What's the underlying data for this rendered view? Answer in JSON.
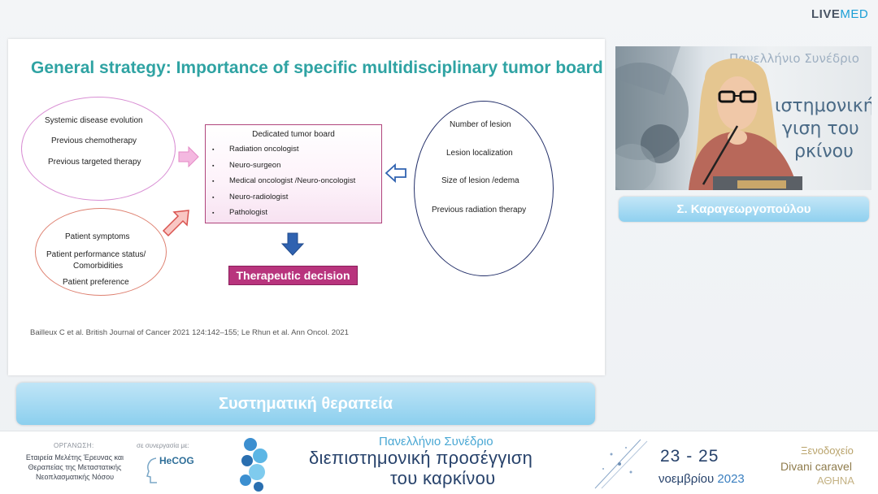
{
  "brand": {
    "part1": "LIVE",
    "part2": "MED"
  },
  "slide": {
    "title": "General strategy: Importance of specific multidisciplinary tumor board",
    "left_ellipse_top": [
      "Systemic disease evolution",
      "Previous chemotherapy",
      "Previous targeted therapy"
    ],
    "left_ellipse_bottom": [
      "Patient symptoms",
      "Patient performance status/",
      "Comorbidities",
      "Patient preference"
    ],
    "right_ellipse": [
      "Number of lesion",
      "Lesion localization",
      "Size of lesion /edema",
      "Previous radiation therapy"
    ],
    "board": {
      "title": "Dedicated tumor board",
      "bullet": "▪",
      "items": [
        "Radiation oncologist",
        "Neuro-surgeon",
        "Medical oncologist /Neuro-oncologist",
        "Neuro-radiologist",
        "Pathologist"
      ]
    },
    "decision": "Therapeutic decision",
    "reference": "Bailleux C et al. British Journal of Cancer 2021 124:142–155; Le Rhun et al.  Ann Oncol. 2021"
  },
  "speaker": {
    "name": "Σ. Καραγεωργοπούλου"
  },
  "topic": "Συστηματική θεραπεία",
  "footer": {
    "organizer_label": "ΟΡΓΑΝΩΣΗ:",
    "organizer_lines": [
      "Εταιρεία Μελέτης Έρευνας και",
      "Θεραπείας της Μεταστατικής",
      "Νεοπλασματικής Νόσου"
    ],
    "collab_label": "σε συνεργασία με:",
    "collab_name": "HeCOG",
    "conf_prefix": "Πανελλήνιο Συνέδριο",
    "conf_line1": "διεπιστημονική προσέγγιση",
    "conf_line2": "του καρκίνου",
    "dates": "23 - 25",
    "month": "νοεμβρίου",
    "year": "2023",
    "venue_line1": "Ξενοδοχείο",
    "venue_line2": "Divani caravel",
    "venue_line3": "ΑΘΗΝΑ"
  },
  "colors": {
    "title_teal": "#2fa3a3",
    "decision_magenta": "#b8347d",
    "arrow_blue": "#2f62b0",
    "bar_blue": "#8fd0ef"
  }
}
